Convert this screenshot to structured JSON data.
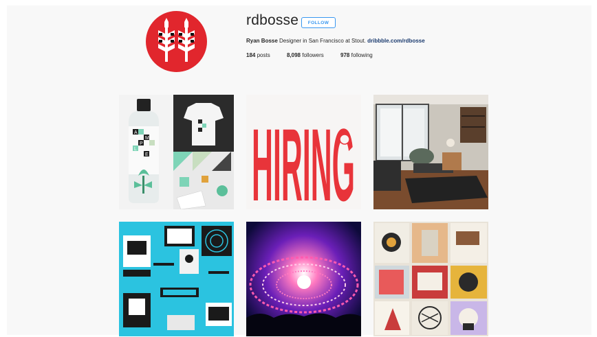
{
  "profile": {
    "username": "rdbosse",
    "follow_label": "FOLLOW",
    "full_name": "Ryan Bosse",
    "bio_text": "Designer in San Francisco at Stout.",
    "website": "dribbble.com/rdbosse",
    "stats": {
      "posts_count": "184",
      "posts_label": "posts",
      "followers_count": "8,098",
      "followers_label": "followers",
      "following_count": "978",
      "following_label": "following"
    }
  },
  "posts": [
    {
      "name": "post-ample-branding",
      "label_letters": [
        "A",
        "M",
        "P",
        "L",
        "E"
      ]
    },
    {
      "name": "post-hiring-poster",
      "text": "HIRING"
    },
    {
      "name": "post-living-room"
    },
    {
      "name": "post-computer-illustration"
    },
    {
      "name": "post-concert-stage"
    },
    {
      "name": "post-illustration-collage"
    }
  ],
  "colors": {
    "brand_red": "#e1262d",
    "follow_blue": "#3897f0",
    "link_navy": "#1a3a6e",
    "cyan_illustration": "#2bc3e0",
    "hiring_red": "#e8343a"
  }
}
